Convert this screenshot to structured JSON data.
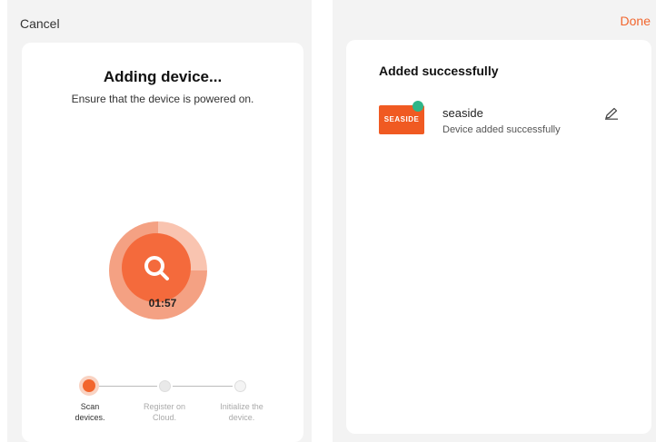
{
  "left": {
    "cancel_label": "Cancel",
    "title": "Adding device...",
    "subtitle": "Ensure that the device is powered on.",
    "timer": "01:57",
    "steps": [
      {
        "line1": "Scan",
        "line2": "devices."
      },
      {
        "line1": "Register on",
        "line2": "Cloud."
      },
      {
        "line1": "Initialize the",
        "line2": "device."
      }
    ],
    "scan_progress_fraction": 0.25
  },
  "right": {
    "done_label": "Done",
    "title": "Added successfully",
    "device": {
      "logo_text": "SEASIDE",
      "name": "seaside",
      "status": "Device added successfully"
    }
  },
  "colors": {
    "accent": "#f2662e",
    "online": "#2fb588"
  },
  "icons": [
    "search-icon",
    "edit-icon"
  ]
}
